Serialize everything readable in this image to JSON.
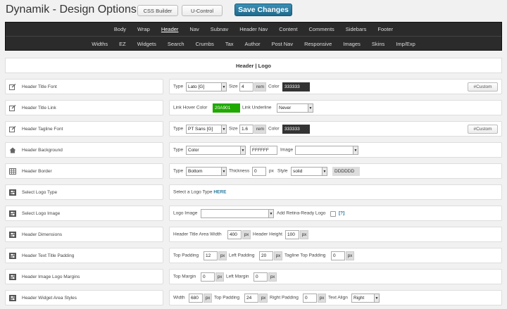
{
  "header": {
    "title": "Dynamik - Design Options",
    "css_builder_label": "CSS Builder",
    "u_control_label": "U-Control",
    "save_label": "Save Changes"
  },
  "nav": {
    "row1": [
      "Body",
      "Wrap",
      "Header",
      "Nav",
      "Subnav",
      "Header Nav",
      "Content",
      "Comments",
      "Sidebars",
      "Footer"
    ],
    "row2": [
      "Widths",
      "EZ",
      "Widgets",
      "Search",
      "Crumbs",
      "Tax",
      "Author",
      "Post Nav",
      "Responsive",
      "Images",
      "Skins",
      "Imp/Exp"
    ],
    "active": "Header"
  },
  "section_title": "Header | Logo",
  "rows": {
    "title_font": {
      "label": "Header Title Font",
      "icon": "edit-icon",
      "type_label": "Type",
      "type_value": "Lato [G]",
      "size_label": "Size",
      "size_value": "4",
      "size_unit": "rem",
      "color_label": "Color",
      "color_value": "333333",
      "custom_label": "#Custom"
    },
    "title_link": {
      "label": "Header Title Link",
      "icon": "edit-icon",
      "hover_label": "Link Hover Color",
      "hover_value": "20A901",
      "underline_label": "Link Underline",
      "underline_value": "Never"
    },
    "tagline_font": {
      "label": "Header Tagline Font",
      "icon": "edit-icon",
      "type_label": "Type",
      "type_value": "PT Sans [G]",
      "size_label": "Size",
      "size_value": "1.6",
      "size_unit": "rem",
      "color_label": "Color",
      "color_value": "333333",
      "custom_label": "#Custom"
    },
    "background": {
      "label": "Header Background",
      "icon": "home-icon",
      "type_label": "Type",
      "type_value": "Color",
      "color_value": "FFFFFF",
      "image_label": "Image",
      "image_value": ""
    },
    "border": {
      "label": "Header Border",
      "icon": "table-icon",
      "type_label": "Type",
      "type_value": "Bottom",
      "thickness_label": "Thickness",
      "thickness_value": "0",
      "thickness_unit": "px",
      "style_label": "Style",
      "style_value": "solid",
      "color_value": "DDDDDD"
    },
    "logo_type": {
      "label": "Select Logo Type",
      "icon": "settings-icon",
      "prompt": "Select a Logo Type",
      "link": "HERE"
    },
    "logo_image": {
      "label": "Select Logo Image",
      "icon": "settings-icon",
      "logo_label": "Logo Image",
      "logo_value": "",
      "retina_label": "Add Retina-Ready Logo",
      "help": "[?]"
    },
    "dimensions": {
      "label": "Header Dimensions",
      "icon": "settings-icon",
      "width_label": "Header Title Area Width",
      "width_value": "400",
      "width_unit": "px",
      "height_label": "Header Height",
      "height_value": "100",
      "height_unit": "px"
    },
    "text_padding": {
      "label": "Header Text Title Padding",
      "icon": "settings-icon",
      "top_label": "Top Padding",
      "top_value": "12",
      "top_unit": "px",
      "left_label": "Left Padding",
      "left_value": "20",
      "left_unit": "px",
      "tagline_label": "Tagline Top Padding",
      "tagline_value": "0",
      "tagline_unit": "px"
    },
    "logo_margins": {
      "label": "Header Image Logo Margins",
      "icon": "settings-icon",
      "top_label": "Top Margin",
      "top_value": "0",
      "top_unit": "px",
      "left_label": "Left Margin",
      "left_value": "0",
      "left_unit": "px"
    },
    "widget_area": {
      "label": "Header Widget Area Styles",
      "icon": "settings-icon",
      "width_label": "Width",
      "width_value": "680",
      "width_unit": "px",
      "top_label": "Top Padding",
      "top_value": "24",
      "top_unit": "px",
      "right_label": "Right Padding",
      "right_value": "0",
      "right_unit": "px",
      "align_label": "Text Align",
      "align_value": "Right"
    }
  },
  "colors": {
    "accent": "#21759b",
    "nav_bg": "#2b2b2b",
    "dark_swatch": "#333333",
    "green_swatch": "#20A901",
    "grey_swatch": "#DDDDDD"
  }
}
